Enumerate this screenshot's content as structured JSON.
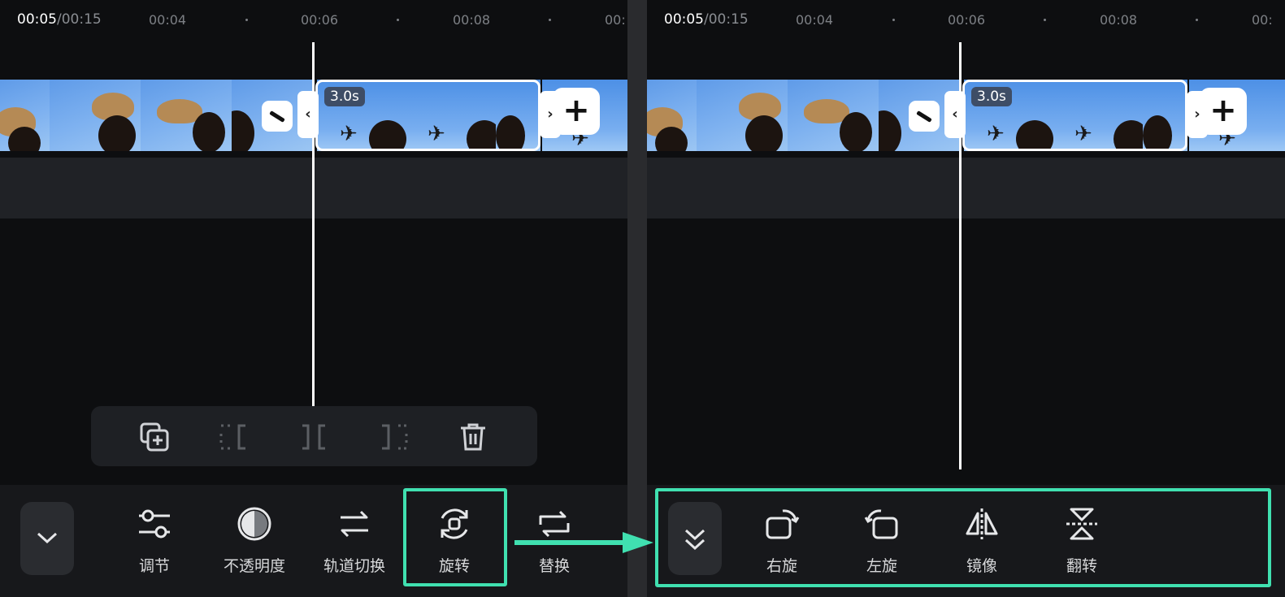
{
  "left_panel": {
    "timecode_current": "00:05",
    "timecode_total": "/00:15",
    "ruler_ticks": [
      "00:04",
      "00:06",
      "00:08",
      "00:"
    ],
    "clip_duration": "3.0s",
    "edit_bar_icons": [
      "duplicate-icon",
      "split-left-icon",
      "split-icon",
      "split-right-icon",
      "delete-icon"
    ],
    "tools": [
      "调节",
      "不透明度",
      "轨道切换",
      "旋转",
      "替换"
    ]
  },
  "right_panel": {
    "timecode_current": "00:05",
    "timecode_total": "/00:15",
    "ruler_ticks": [
      "00:04",
      "00:06",
      "00:08",
      "00:"
    ],
    "clip_duration": "3.0s",
    "tools": [
      "右旋",
      "左旋",
      "镜像",
      "翻转"
    ]
  },
  "colors": {
    "highlight": "#40e0b0",
    "background": "#0d0e10",
    "toolbar": "#17181b"
  }
}
